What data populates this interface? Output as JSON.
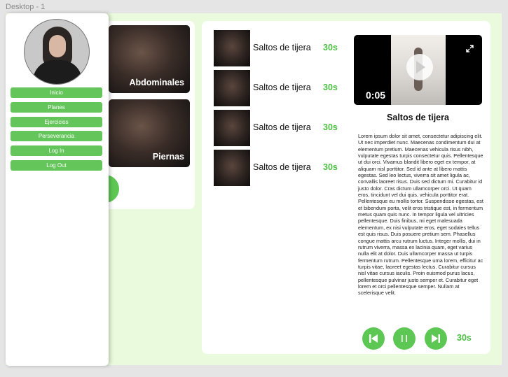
{
  "frame_label": "Desktop - 1",
  "sidebar": {
    "nav": [
      {
        "label": "Inicio"
      },
      {
        "label": "Planes"
      },
      {
        "label": "Ejercicios"
      },
      {
        "label": "Perseverancia"
      },
      {
        "label": "Log In"
      },
      {
        "label": "Log Out"
      }
    ]
  },
  "categories": [
    {
      "label": "Abdominales"
    },
    {
      "label": "Piernas"
    }
  ],
  "exercises": [
    {
      "name": "Saltos de tijera",
      "time": "30s"
    },
    {
      "name": "Saltos de tijera",
      "time": "30s"
    },
    {
      "name": "Saltos de tijera",
      "time": "30s"
    },
    {
      "name": "Saltos de tijera",
      "time": "30s"
    }
  ],
  "video": {
    "timestamp": "0:05"
  },
  "detail": {
    "title": "Saltos de tijera",
    "description": "Lorem ipsum dolor sit amet, consectetur adipiscing elit. Ut nec imperdiet nunc. Maecenas condimentum dui at elementum pretium. Maecenas vehicula risus nibh, vulputate egestas turpis consectetur quis. Pellentesque ut dui orci. Vivamus blandit libero eget ex tempor, at aliquam nisl porttitor. Sed id ante at libero mattis egestas. Sed leo lectus, viverra sit amet ligula ac, convallis laoreet risus. Duis sed dictum mi. Curabitur id justo dolor. Cras dictum ullamcorper orci. Ut quam eros, tincidunt vel dui quis, vehicula porttitor erat. Pellentesque eu mollis tortor. Suspendisse egestas, est et bibendum porta, velit eros tristique est, in fermentum metus quam quis nunc. In tempor ligula vel ultricies pellentesque. Duis finibus, mi eget malesuada elementum, ex nisi vulputate eros, eget sodales tellus est quis risus. Duis posuere pretium sem. Phasellus congue mattis arcu rutrum luctus. Integer mollis, dui in rutrum viverra, massa ex lacinia quam, eget varius nulla elit at dolor. Duis ullamcorper massa ut turpis fermentum rutrum. Pellentesque urna lorem, efficitur ac turpis vitae, laoreet egestas lectus. Curabitur cursus nisl vitae cursus iaculis. Proin euismod purus lacus, pellentesque pulvinar justo semper et. Curabitur eget lorem et orci pellentesque semper. Nullam at scelerisque velit."
  },
  "player": {
    "time": "30s"
  },
  "colors": {
    "accent": "#5dc754",
    "accent_text": "#4cbe43",
    "canvas": "#e9fbdc"
  }
}
